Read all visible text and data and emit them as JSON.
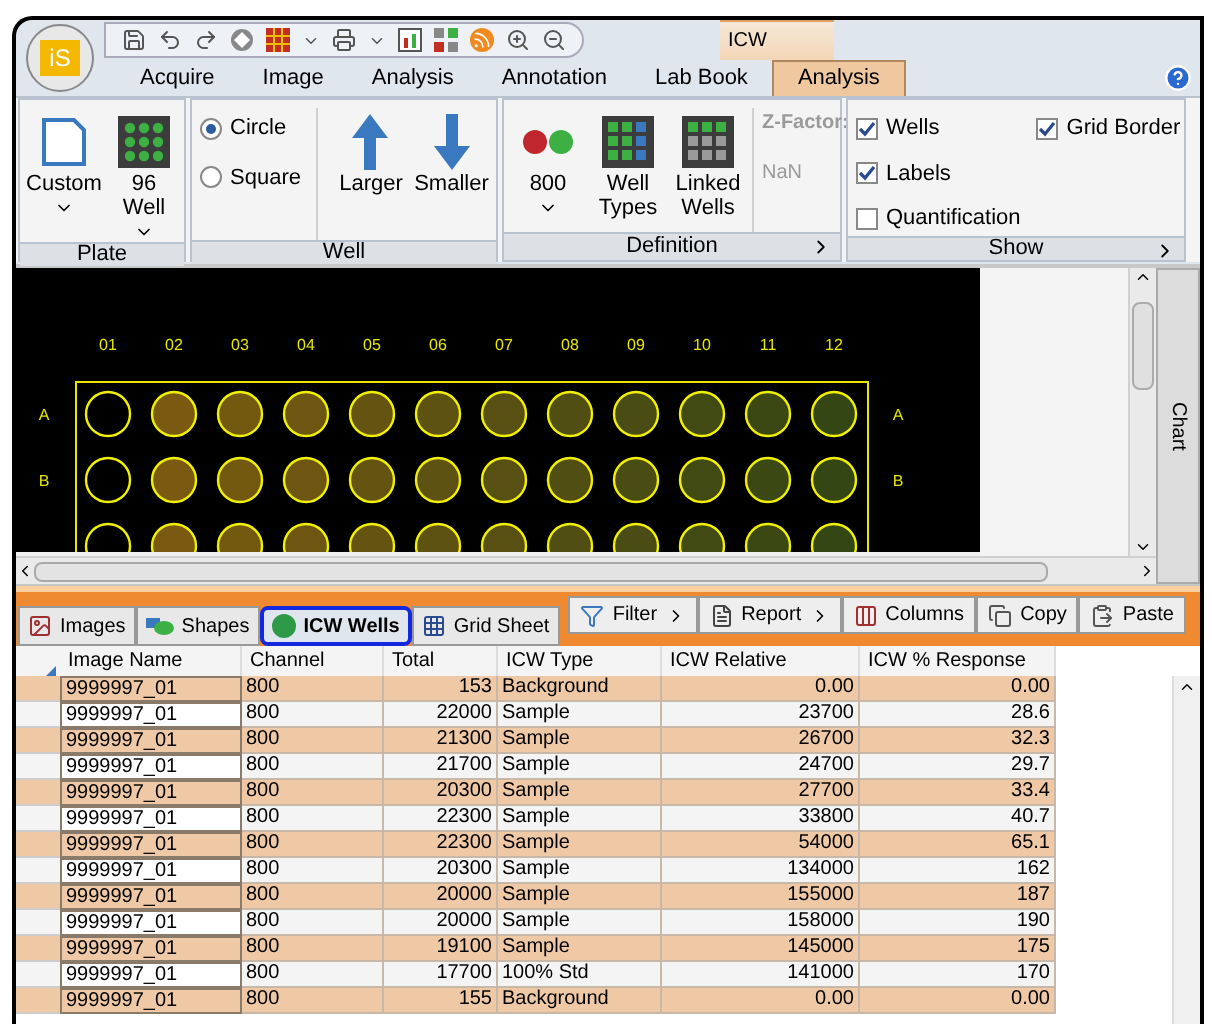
{
  "app_logo": "iS",
  "contextual_group": "ICW",
  "tabs": [
    {
      "label": "Acquire",
      "selected": false
    },
    {
      "label": "Image",
      "selected": false
    },
    {
      "label": "Analysis",
      "selected": false
    },
    {
      "label": "Annotation",
      "selected": false
    },
    {
      "label": "Lab Book",
      "selected": false
    },
    {
      "label": "Analysis",
      "selected": true
    }
  ],
  "ribbon": [
    {
      "label": "Plate",
      "launcher": false,
      "items": [
        {
          "kind": "button",
          "label": "Custom",
          "dropdown": true
        },
        {
          "kind": "button",
          "label": "96 Well",
          "dropdown": true
        }
      ]
    },
    {
      "label": "Well",
      "launcher": false,
      "items": [
        {
          "kind": "radios",
          "options": [
            {
              "label": "Circle",
              "selected": true
            },
            {
              "label": "Square",
              "selected": false
            }
          ]
        },
        {
          "kind": "button",
          "label": "Larger",
          "dropdown": false
        },
        {
          "kind": "button",
          "label": "Smaller",
          "dropdown": false
        }
      ]
    },
    {
      "label": "Definition",
      "launcher": true,
      "items": [
        {
          "kind": "button",
          "label": "800",
          "dropdown": true
        },
        {
          "kind": "button",
          "label": "Well Types",
          "dropdown": false
        },
        {
          "kind": "button",
          "label": "Linked Wells",
          "dropdown": false
        },
        {
          "kind": "readout",
          "label": "Z-Factor:",
          "value": "NaN"
        }
      ]
    },
    {
      "label": "Show",
      "launcher": true,
      "items": [
        {
          "kind": "checks",
          "options": [
            {
              "label": "Wells",
              "checked": true
            },
            {
              "label": "Labels",
              "checked": true
            },
            {
              "label": "Quantification",
              "checked": false
            },
            {
              "label": "Grid Border",
              "checked": true
            }
          ]
        }
      ]
    }
  ],
  "plate": {
    "columns": [
      "01",
      "02",
      "03",
      "04",
      "05",
      "06",
      "07",
      "08",
      "09",
      "10",
      "11",
      "12"
    ],
    "rows": [
      {
        "left": "A",
        "right": "A"
      },
      {
        "left": "B",
        "right": "B"
      }
    ]
  },
  "side_tab": "Chart",
  "view_tabs": [
    {
      "label": "Images",
      "selected": false
    },
    {
      "label": "Shapes",
      "selected": false
    },
    {
      "label": "ICW Wells",
      "selected": true
    },
    {
      "label": "Grid Sheet",
      "selected": false
    }
  ],
  "toolbar": [
    {
      "label": "Filter",
      "menu": true
    },
    {
      "label": "Report",
      "menu": true
    },
    {
      "label": "Columns",
      "menu": false
    },
    {
      "label": "Copy",
      "menu": false
    },
    {
      "label": "Paste",
      "menu": false
    }
  ],
  "table": {
    "columns": [
      "Image Name",
      "Channel",
      "Total",
      "ICW Type",
      "ICW Relative",
      "ICW % Response"
    ],
    "rows": [
      [
        "9999997_01",
        "800",
        "153",
        "Background",
        "0.00",
        "0.00"
      ],
      [
        "9999997_01",
        "800",
        "22000",
        "Sample",
        "23700",
        "28.6"
      ],
      [
        "9999997_01",
        "800",
        "21300",
        "Sample",
        "26700",
        "32.3"
      ],
      [
        "9999997_01",
        "800",
        "21700",
        "Sample",
        "24700",
        "29.7"
      ],
      [
        "9999997_01",
        "800",
        "20300",
        "Sample",
        "27700",
        "33.4"
      ],
      [
        "9999997_01",
        "800",
        "22300",
        "Sample",
        "33800",
        "40.7"
      ],
      [
        "9999997_01",
        "800",
        "22300",
        "Sample",
        "54000",
        "65.1"
      ],
      [
        "9999997_01",
        "800",
        "20300",
        "Sample",
        "134000",
        "162"
      ],
      [
        "9999997_01",
        "800",
        "20000",
        "Sample",
        "155000",
        "187"
      ],
      [
        "9999997_01",
        "800",
        "20000",
        "Sample",
        "158000",
        "190"
      ],
      [
        "9999997_01",
        "800",
        "19100",
        "Sample",
        "145000",
        "175"
      ],
      [
        "9999997_01",
        "800",
        "17700",
        "100% Std",
        "141000",
        "170"
      ],
      [
        "9999997_01",
        "800",
        "155",
        "Background",
        "0.00",
        "0.00"
      ]
    ]
  }
}
